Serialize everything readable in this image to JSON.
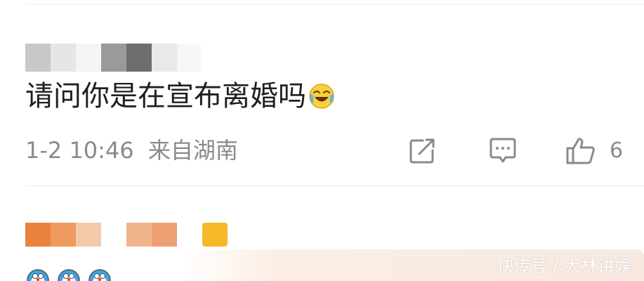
{
  "comment": {
    "text": "请问你是在宣布离婚吗",
    "emoji": "laughing-crying-emoji-icon",
    "timestamp": "1-2 10:46",
    "location": "来自湖南",
    "actions": {
      "share_icon": "share-icon",
      "reply_icon": "comment-icon",
      "like_icon": "thumbs-up-icon",
      "like_count": "6"
    }
  },
  "watermark": "快传号 / 大林讲娱",
  "colors": {
    "text_primary": "#1f1f1f",
    "text_secondary": "#8a8a8a",
    "divider": "#ececec",
    "mosaic_orange": "#e8823c",
    "mosaic_light_orange": "#f0b48c",
    "badge_yellow": "#f6b92a"
  }
}
